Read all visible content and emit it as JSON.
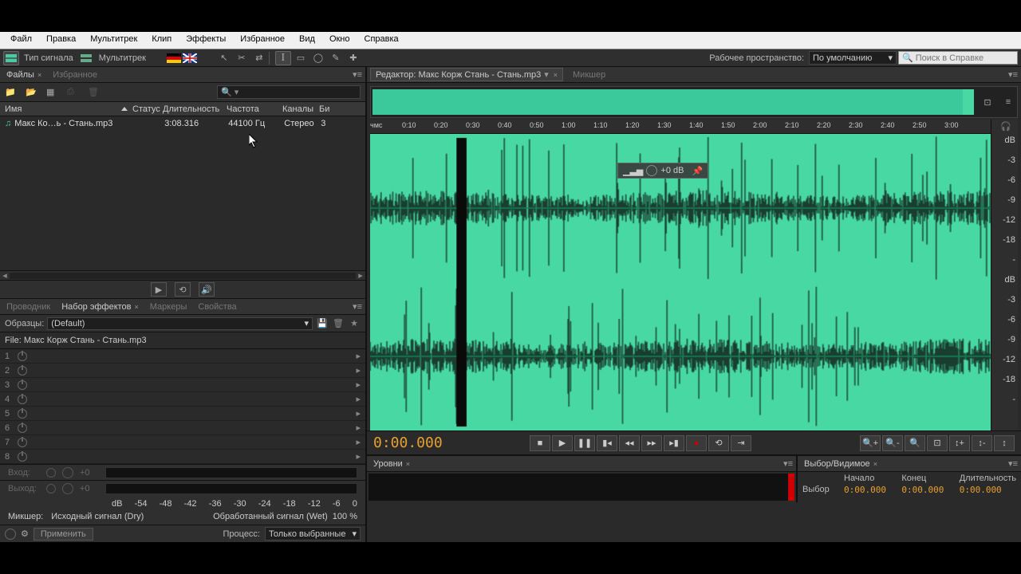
{
  "menu": [
    "Файл",
    "Правка",
    "Мультитрек",
    "Клип",
    "Эффекты",
    "Избранное",
    "Вид",
    "Окно",
    "Справка"
  ],
  "toolbar": {
    "wave": "Тип сигнала",
    "multi": "Мультитрек",
    "ws_label": "Рабочее пространство:",
    "ws_value": "По умолчанию",
    "search_ph": "Поиск в Справке"
  },
  "files": {
    "tab": "Файлы",
    "fav": "Избранное",
    "cols": {
      "name": "Имя",
      "status": "Статус",
      "dur": "Длительность",
      "freq": "Частота",
      "ch": "Каналы",
      "bi": "Би"
    },
    "row": {
      "name": "Макс Ко…ь - Стань.mp3",
      "dur": "3:08.316",
      "freq": "44100 Гц",
      "ch": "Стерео",
      "bi": "3"
    }
  },
  "fx": {
    "tabs": {
      "explorer": "Проводник",
      "rack": "Набор эффектов",
      "markers": "Маркеры",
      "props": "Свойства"
    },
    "preset_lbl": "Образцы:",
    "preset_val": "(Default)",
    "file_lbl": "File: Макс Корж Стань - Стань.mp3",
    "slots": [
      1,
      2,
      3,
      4,
      5,
      6,
      7,
      8
    ],
    "in": "Вход:",
    "out": "Выход:",
    "in_val": "+0",
    "out_val": "+0",
    "db": [
      "dB",
      "-54",
      "-48",
      "-42",
      "-36",
      "-30",
      "-24",
      "-18",
      "-12",
      "-6",
      "0"
    ],
    "mixer_lbl": "Микшер:",
    "dry": "Исходный сигнал (Dry)",
    "wet": "Обработанный сигнал (Wet)",
    "pct": "100 %",
    "apply": "Применить",
    "proc_lbl": "Процесс:",
    "proc_val": "Только выбранные"
  },
  "editor": {
    "tab": "Редактор: Макс Корж Стань - Стань.mp3",
    "mixer": "Микшер",
    "ticks": [
      "чмс",
      "0:10",
      "0:20",
      "0:30",
      "0:40",
      "0:50",
      "1:00",
      "1:10",
      "1:20",
      "1:30",
      "1:40",
      "1:50",
      "2:00",
      "2:10",
      "2:20",
      "2:30",
      "2:40",
      "2:50",
      "3:00"
    ],
    "db_marks": [
      "dB",
      "-3",
      "-6",
      "-9",
      "-12",
      "-18",
      "-",
      "dB",
      "-3",
      "-6",
      "-9",
      "-12",
      "-18",
      "-"
    ],
    "hud": "+0 dB",
    "time": "0:00.000"
  },
  "levels": {
    "tab": "Уровни"
  },
  "sel": {
    "tab": "Выбор/Видимое",
    "start": "Начало",
    "end": "Конец",
    "dur": "Длительность",
    "rows": [
      {
        "lbl": "Выбор",
        "a": "0:00.000",
        "b": "0:00.000",
        "c": "0:00.000"
      }
    ]
  }
}
